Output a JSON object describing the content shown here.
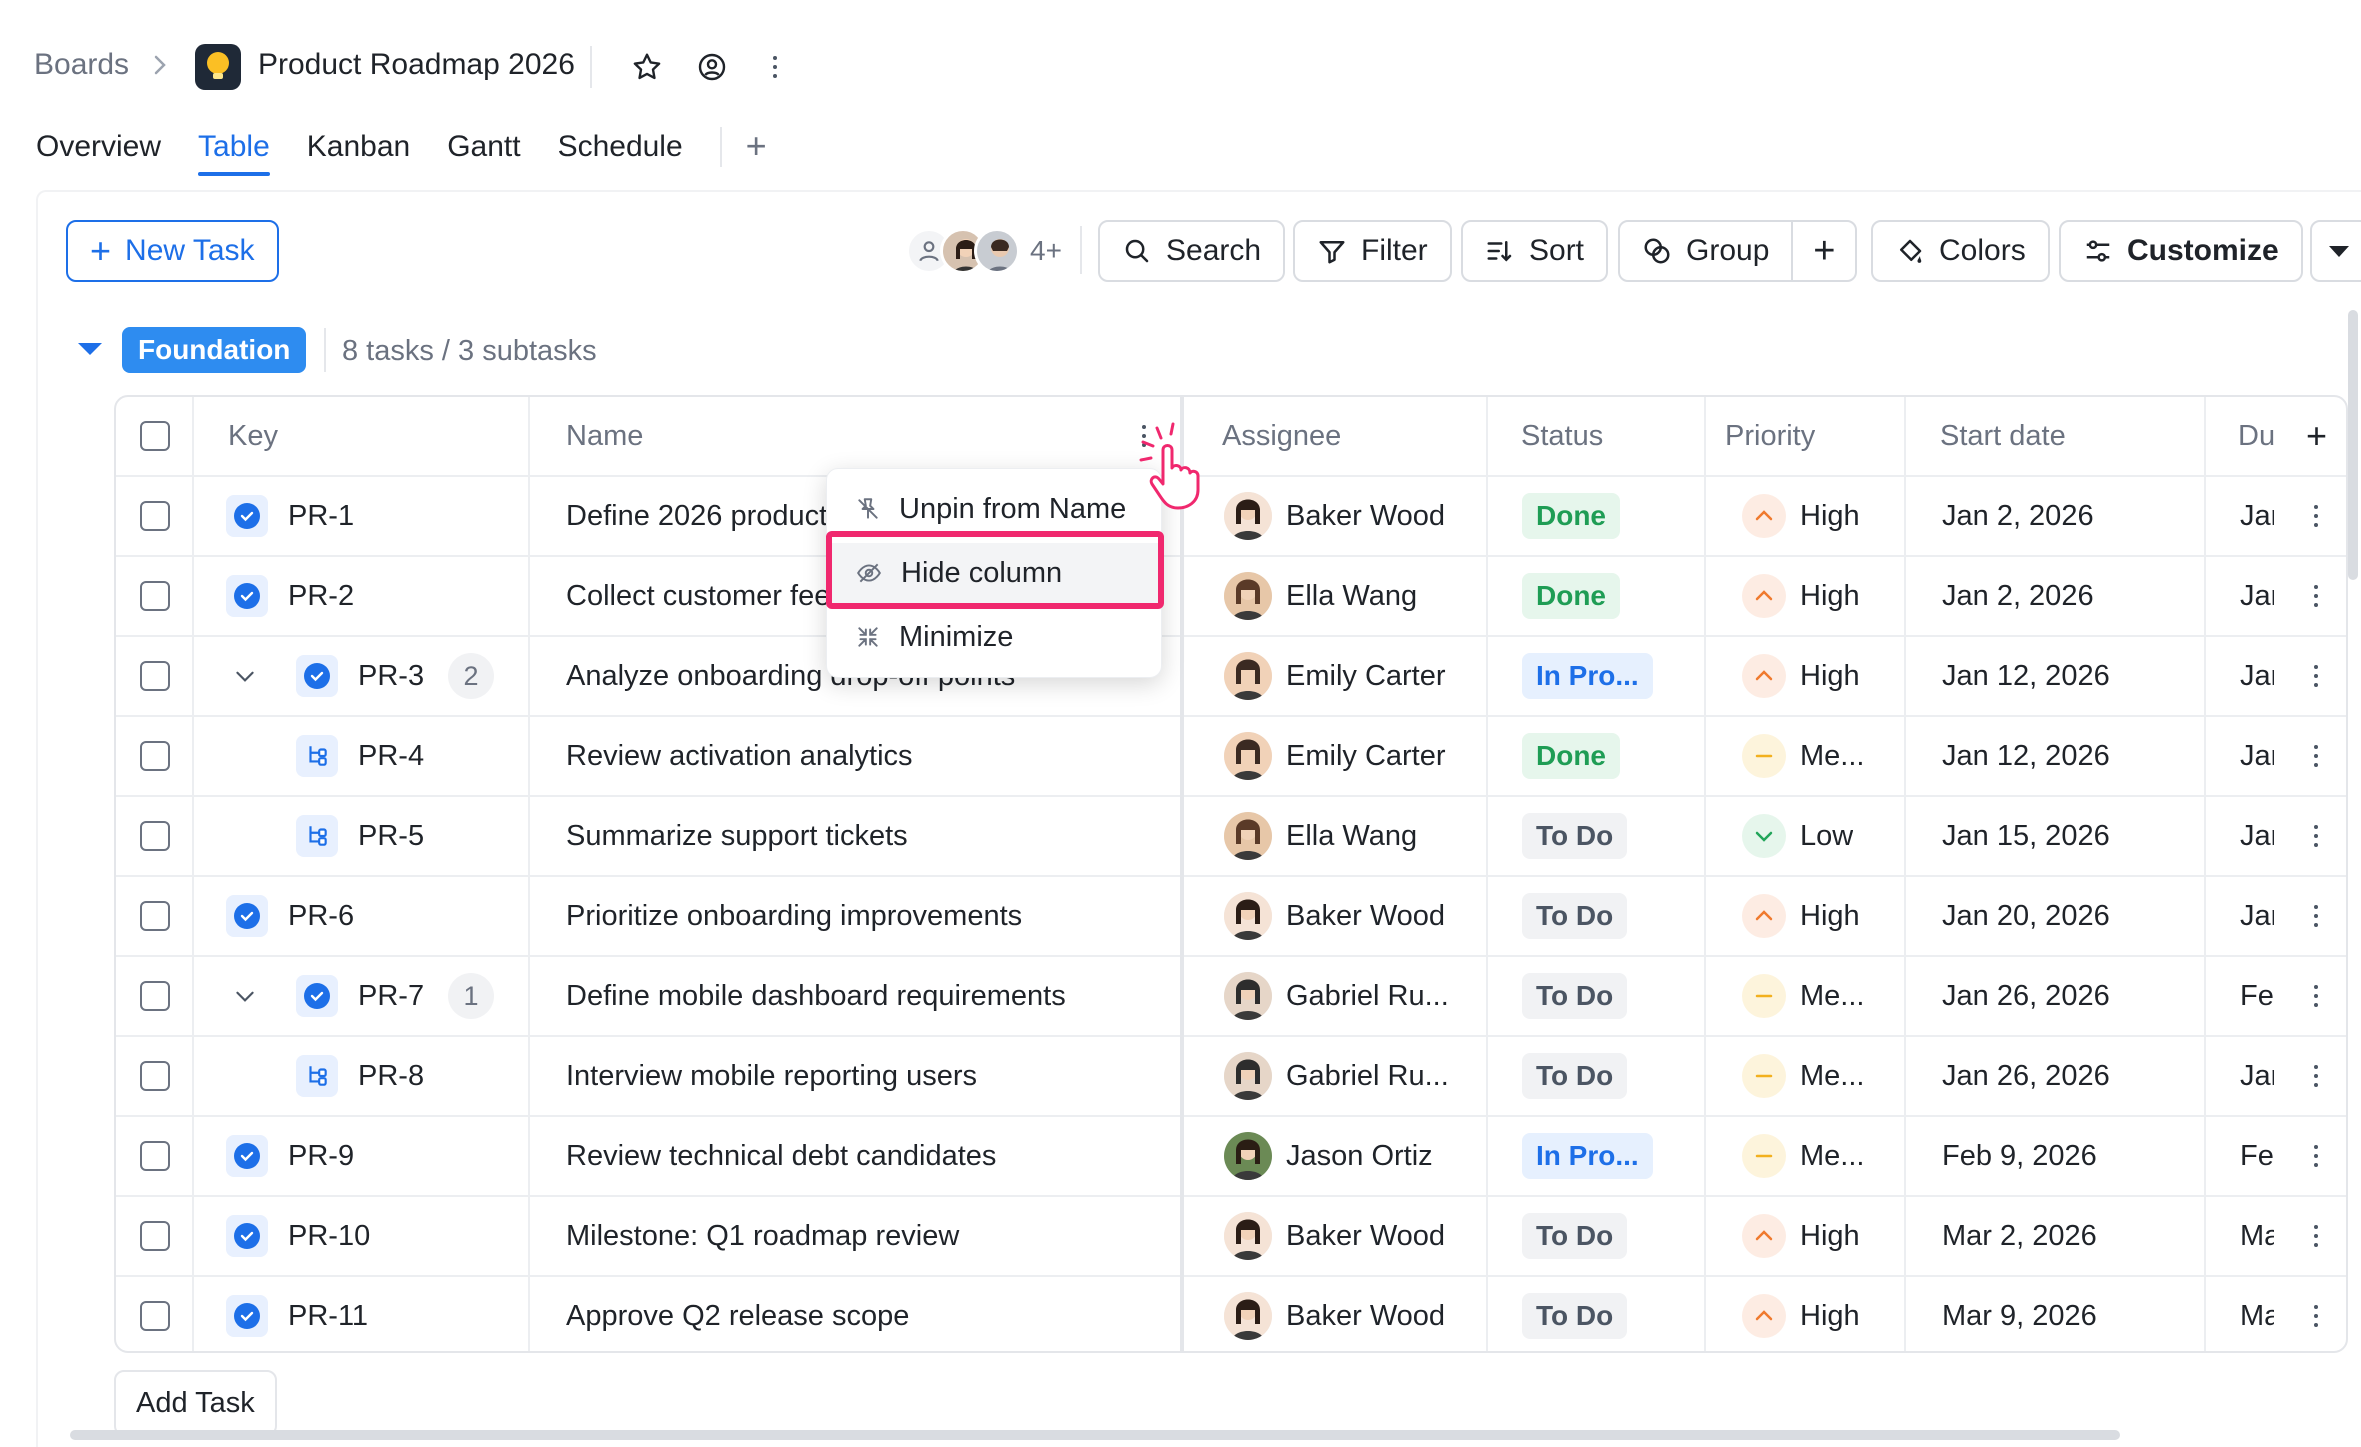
{
  "header": {
    "breadcrumb_root": "Boards",
    "board_title": "Product Roadmap 2026"
  },
  "tabs": [
    {
      "label": "Overview",
      "active": false
    },
    {
      "label": "Table",
      "active": true
    },
    {
      "label": "Kanban",
      "active": false
    },
    {
      "label": "Gantt",
      "active": false
    },
    {
      "label": "Schedule",
      "active": false
    }
  ],
  "toolbar": {
    "new_task": "New Task",
    "members_more": "4+",
    "search": "Search",
    "filter": "Filter",
    "sort": "Sort",
    "group": "Group",
    "colors": "Colors",
    "customize": "Customize"
  },
  "group": {
    "name": "Foundation",
    "count": "8 tasks / 3 subtasks"
  },
  "columns": {
    "key": "Key",
    "name": "Name",
    "assignee": "Assignee",
    "status": "Status",
    "priority": "Priority",
    "start_date": "Start date",
    "due": "Du"
  },
  "rows": [
    {
      "key": "PR-1",
      "name": "Define 2026 product",
      "assignee": "Baker Wood",
      "status": "Done",
      "priority": "High",
      "start": "Jan 2, 2026",
      "due": "Jar",
      "level": 0
    },
    {
      "key": "PR-2",
      "name": "Collect customer fee",
      "assignee": "Ella Wang",
      "status": "Done",
      "priority": "High",
      "start": "Jan 2, 2026",
      "due": "Jar",
      "level": 0
    },
    {
      "key": "PR-3",
      "name": "Analyze onboarding drop-off points",
      "assignee": "Emily Carter",
      "status": "In Pro...",
      "priority": "High",
      "start": "Jan 12, 2026",
      "due": "Jar",
      "level": 0,
      "expand": true,
      "sub_count": "2"
    },
    {
      "key": "PR-4",
      "name": "Review activation analytics",
      "assignee": "Emily Carter",
      "status": "Done",
      "priority": "Me...",
      "start": "Jan 12, 2026",
      "due": "Jar",
      "level": 1
    },
    {
      "key": "PR-5",
      "name": "Summarize support tickets",
      "assignee": "Ella Wang",
      "status": "To Do",
      "priority": "Low",
      "start": "Jan 15, 2026",
      "due": "Jar",
      "level": 1
    },
    {
      "key": "PR-6",
      "name": "Prioritize onboarding improvements",
      "assignee": "Baker Wood",
      "status": "To Do",
      "priority": "High",
      "start": "Jan 20, 2026",
      "due": "Jar",
      "level": 0
    },
    {
      "key": "PR-7",
      "name": "Define mobile dashboard requirements",
      "assignee": "Gabriel Ru...",
      "status": "To Do",
      "priority": "Me...",
      "start": "Jan 26, 2026",
      "due": "Fe",
      "level": 0,
      "expand": true,
      "sub_count": "1"
    },
    {
      "key": "PR-8",
      "name": "Interview mobile reporting users",
      "assignee": "Gabriel Ru...",
      "status": "To Do",
      "priority": "Me...",
      "start": "Jan 26, 2026",
      "due": "Jar",
      "level": 1
    },
    {
      "key": "PR-9",
      "name": "Review technical debt candidates",
      "assignee": "Jason Ortiz",
      "status": "In Pro...",
      "priority": "Me...",
      "start": "Feb 9, 2026",
      "due": "Fe",
      "level": 0
    },
    {
      "key": "PR-10",
      "name": "Milestone: Q1 roadmap review",
      "assignee": "Baker Wood",
      "status": "To Do",
      "priority": "High",
      "start": "Mar 2, 2026",
      "due": "Ma",
      "level": 0
    },
    {
      "key": "PR-11",
      "name": "Approve Q2 release scope",
      "assignee": "Baker Wood",
      "status": "To Do",
      "priority": "High",
      "start": "Mar 9, 2026",
      "due": "Ma",
      "level": 0
    }
  ],
  "context_menu": {
    "items": [
      "Unpin from Name",
      "Hide column",
      "Minimize"
    ],
    "highlighted": "Hide column"
  },
  "footer": {
    "add_task": "Add Task"
  },
  "colors": {
    "accent": "#1d6fe8",
    "group_pill": "#2e8cf0",
    "highlight": "#f0286e"
  }
}
